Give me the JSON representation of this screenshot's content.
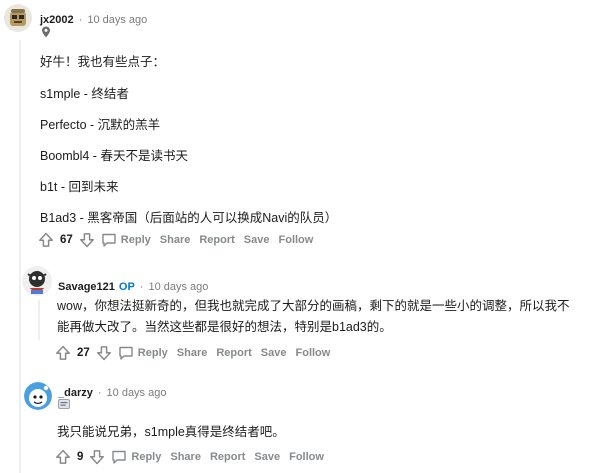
{
  "comments": [
    {
      "username": "jx2002",
      "time": "10 days ago",
      "lines": [
        "好牛！我也有些点子：",
        "s1mple - 终结者",
        "Perfecto - 沉默的羔羊",
        "Boombl4 - 春天不是读书天",
        "b1t - 回到未来",
        "B1ad3 - 黑客帝国（后面站的人可以换成Navi的队员）"
      ],
      "score": "67",
      "actions": {
        "reply": "Reply",
        "share": "Share",
        "report": "Report",
        "save": "Save",
        "follow": "Follow"
      }
    },
    {
      "username": "Savage121",
      "op_badge": "OP",
      "time": "10 days ago",
      "text": "wow，你想法挺新奇的，但我也就完成了大部分的画稿，剩下的就是一些小的调整，所以我不能再做大改了。当然这些都是很好的想法，特别是b1ad3的。",
      "score": "27",
      "actions": {
        "reply": "Reply",
        "share": "Share",
        "report": "Report",
        "save": "Save",
        "follow": "Follow"
      }
    },
    {
      "username": "_darzy",
      "time": "10 days ago",
      "text": "我只能说兄弟，s1mple真得是终结者吧。",
      "score": "9",
      "actions": {
        "reply": "Reply",
        "share": "Share",
        "report": "Report",
        "save": "Save",
        "follow": "Follow"
      }
    }
  ],
  "icons": {
    "upvote": "upvote-icon",
    "downvote": "downvote-icon",
    "reply": "comment-bubble-icon"
  }
}
